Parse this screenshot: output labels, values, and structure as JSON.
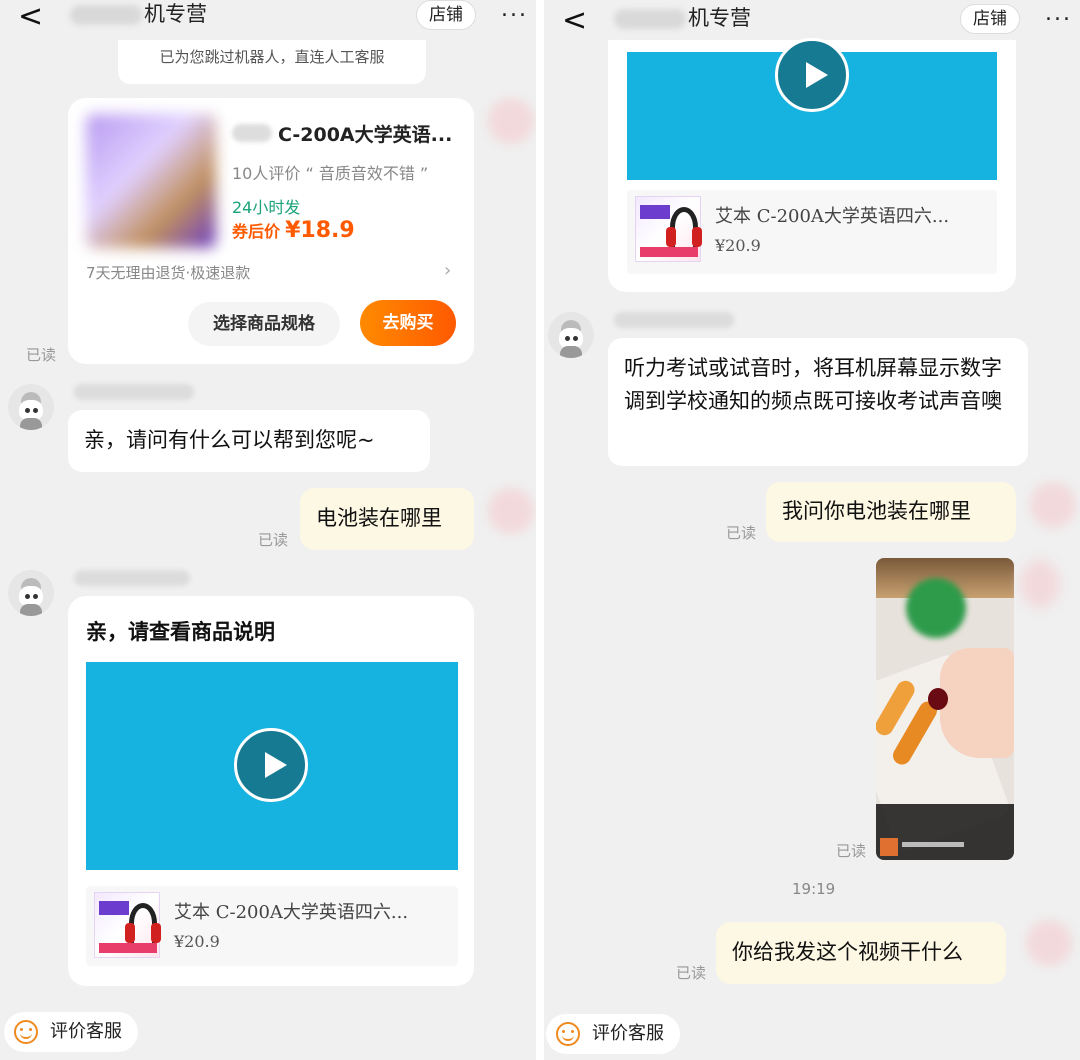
{
  "left": {
    "header": {
      "back": "<",
      "title_suffix": "机专营",
      "shop_button": "店铺",
      "more": "..."
    },
    "system_notice": "已为您跳过机器人，直连人工客服",
    "product_card": {
      "name": "C-200A大学英语...",
      "reviews": "10人评价 “ 音质音效不错 ”",
      "shipping": "24小时发",
      "price_label": "券后价",
      "price": "¥18.9",
      "service": "7天无理由退货·极速退款",
      "spec_button": "选择商品规格",
      "buy_button": "去购买"
    },
    "read_1": "已读",
    "agent_msg_1": "亲，请问有什么可以帮到您呢~",
    "user_msg_1": "电池装在哪里",
    "read_2": "已读",
    "agent_msg_2": "亲，请查看商品说明",
    "video_product": {
      "name": "艾本 C-200A大学英语四六...",
      "price": "¥20.9"
    },
    "rate_button": "评价客服"
  },
  "right": {
    "header": {
      "back": "<",
      "title_suffix": "机专营",
      "shop_button": "店铺",
      "more": "..."
    },
    "video_product": {
      "name": "艾本 C-200A大学英语四六...",
      "price": "¥20.9"
    },
    "agent_msg": "听力考试或试音时，将耳机屏幕显示数字调到学校通知的频点既可接收考试声音噢",
    "user_msg_1": "我问你电池装在哪里",
    "read_1": "已读",
    "read_2": "已读",
    "timestamp": "19:19",
    "user_msg_2": "你给我发这个视频干什么",
    "read_3": "已读",
    "rate_button": "评价客服"
  },
  "colors": {
    "accent_orange": "#ff5a00",
    "shipping_green": "#1aa37a",
    "video_blue": "#16b2e0",
    "user_bubble": "#fdf8e4"
  }
}
